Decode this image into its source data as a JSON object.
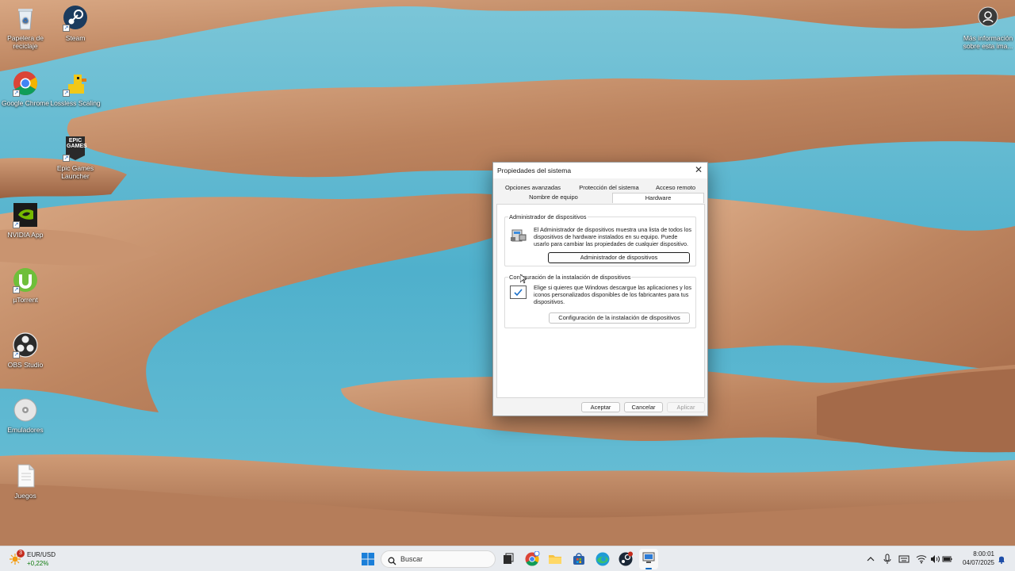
{
  "desktop_icons": [
    {
      "label": "Papelera de reciclaje",
      "icon": "recycle-bin-icon"
    },
    {
      "label": "Steam",
      "icon": "steam-icon"
    },
    {
      "label": "Google Chrome",
      "icon": "chrome-icon"
    },
    {
      "label": "Lossless Scaling",
      "icon": "duck-icon"
    },
    {
      "label": "Epic Games Launcher",
      "icon": "epic-games-icon"
    },
    {
      "label": "NVIDIA App",
      "icon": "nvidia-icon"
    },
    {
      "label": "µTorrent",
      "icon": "utorrent-icon"
    },
    {
      "label": "OBS Studio",
      "icon": "obs-icon"
    },
    {
      "label": "Emuladores",
      "icon": "disc-icon"
    },
    {
      "label": "Juegos",
      "icon": "file-icon"
    },
    {
      "label": "Más información sobre esta ima...",
      "icon": "spotlight-info-icon"
    }
  ],
  "epic_logo_text": "EPIC GAMES",
  "dialog": {
    "title": "Propiedades del sistema",
    "tabs_row1": [
      "Opciones avanzadas",
      "Protección del sistema",
      "Acceso remoto"
    ],
    "tabs_row2": [
      "Nombre de equipo",
      "Hardware"
    ],
    "active_tab": "Hardware",
    "group1": {
      "label": "Administrador de dispositivos",
      "description": "El Administrador de dispositivos muestra una lista de todos los dispositivos de hardware instalados en su equipo. Puede usarlo para cambiar las propiedades de cualquier dispositivo.",
      "button": "Administrador de dispositivos"
    },
    "group2": {
      "label": "Configuración de la instalación de dispositivos",
      "description": "Elige si quieres que Windows descargue las aplicaciones y los iconos personalizados disponibles de los fabricantes para tus dispositivos.",
      "button": "Configuración de la instalación de dispositivos"
    },
    "buttons": {
      "ok": "Aceptar",
      "cancel": "Cancelar",
      "apply": "Aplicar"
    }
  },
  "taskbar": {
    "widget": {
      "title": "EUR/USD",
      "value": "+0,22%",
      "badge": "3"
    },
    "search_placeholder": "Buscar",
    "apps": [
      "start-icon",
      "task-view-icon",
      "chrome-icon",
      "file-explorer-icon",
      "store-icon",
      "edge-icon",
      "steam-icon",
      "system-properties-icon"
    ],
    "tray": {
      "time": "8:00:01",
      "date": "04/07/2025"
    }
  },
  "colors": {
    "accent": "#0067c0",
    "taskbar": "#e8ebef",
    "water": "#5ab5cf",
    "sand": "#c4906a"
  }
}
